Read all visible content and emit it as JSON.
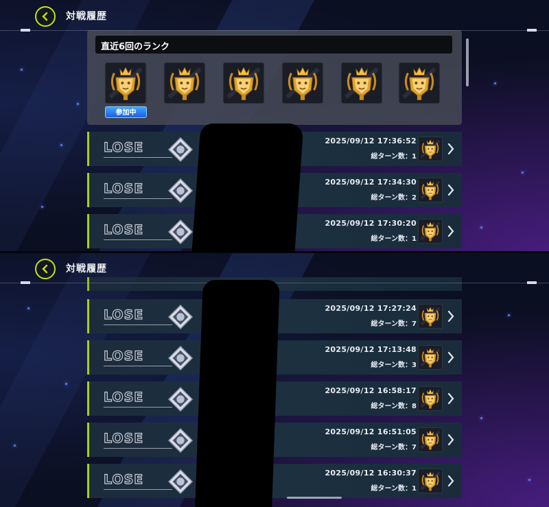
{
  "header": {
    "title": "対戦履歴"
  },
  "rank_section": {
    "title": "直近6回のランク",
    "participating_label": "参加中",
    "medal_count": 6
  },
  "top_matches": [
    {
      "result": "LOSE",
      "time": "2025/09/12 17:36:52",
      "turns": "総ターン数：1",
      "avatar": "purple-dragon-avatar"
    },
    {
      "result": "LOSE",
      "time": "2025/09/12 17:34:30",
      "turns": "総ターン数：2",
      "avatar": "red-hood-avatar"
    },
    {
      "result": "LOSE",
      "time": "2025/09/12 17:30:20",
      "turns": "総ターン数：1",
      "avatar": "silver-crest-avatar"
    }
  ],
  "bottom_matches": [
    {
      "result": "LOSE",
      "time": "2025/09/12 17:27:24",
      "turns": "総ターン数：7",
      "avatar": "silver-crest-avatar"
    },
    {
      "result": "LOSE",
      "time": "2025/09/12 17:13:48",
      "turns": "総ターン数：3",
      "avatar": "red-hex-avatar"
    },
    {
      "result": "LOSE",
      "time": "2025/09/12 16:58:17",
      "turns": "総ターン数：8",
      "avatar": "green-crest-avatar"
    },
    {
      "result": "LOSE",
      "time": "2025/09/12 16:51:05",
      "turns": "総ターン数：7",
      "avatar": "blue-hex-avatar"
    },
    {
      "result": "LOSE",
      "time": "2025/09/12 16:30:37",
      "turns": "総ターン数：1",
      "avatar": "silver-crest-avatar"
    }
  ],
  "colors": {
    "accent": "#a7d400",
    "row_bg": "#1c3040",
    "tag_blue": "#1c5fe0",
    "medal_gold": "#e0a12a"
  }
}
